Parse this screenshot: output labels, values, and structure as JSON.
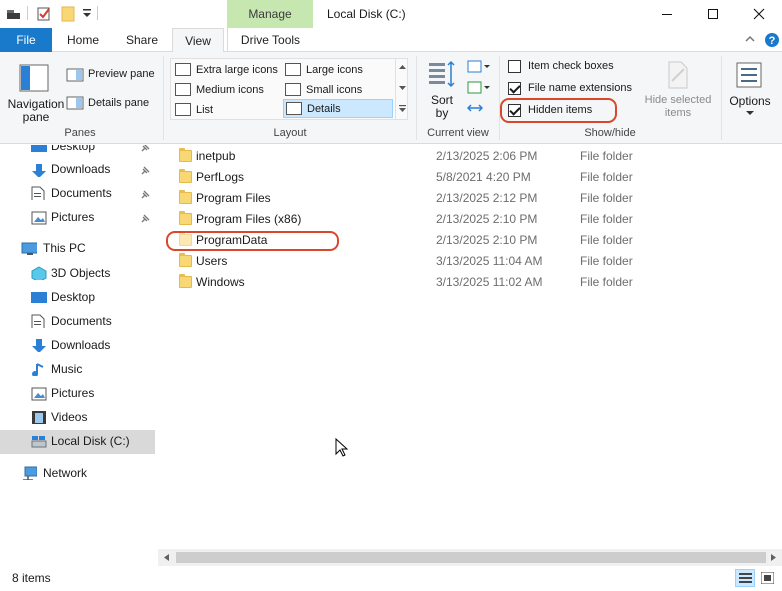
{
  "window": {
    "title": "Local Disk (C:)",
    "contextual_tab": "Manage",
    "controls": {
      "minimize": "—",
      "maximize": "☐",
      "close": "✕"
    }
  },
  "ribbon": {
    "tabs": [
      {
        "label": "File"
      },
      {
        "label": "Home"
      },
      {
        "label": "Share"
      },
      {
        "label": "View"
      },
      {
        "label": "Drive Tools"
      }
    ],
    "active_tab": "View",
    "groups": {
      "panes": {
        "label": "Panes",
        "navigation_pane": "Navigation pane",
        "preview_pane": "Preview pane",
        "details_pane": "Details pane"
      },
      "layout": {
        "label": "Layout",
        "items": [
          "Extra large icons",
          "Large icons",
          "Medium icons",
          "Small icons",
          "List",
          "Details"
        ],
        "selected": "Details"
      },
      "current_view": {
        "label": "Current view",
        "sort_by": "Sort by"
      },
      "show_hide": {
        "label": "Show/hide",
        "item_check_boxes": {
          "label": "Item check boxes",
          "checked": false
        },
        "file_name_extensions": {
          "label": "File name extensions",
          "checked": true
        },
        "hidden_items": {
          "label": "Hidden items",
          "checked": true
        },
        "hide_selected_items": "Hide selected items"
      },
      "options": {
        "label": "Options"
      }
    }
  },
  "sidebar": {
    "quick_access": [
      {
        "label": "Desktop",
        "icon": "desktop-icon",
        "pinned": true
      },
      {
        "label": "Downloads",
        "icon": "downloads-icon",
        "pinned": true
      },
      {
        "label": "Documents",
        "icon": "documents-icon",
        "pinned": true
      },
      {
        "label": "Pictures",
        "icon": "pictures-icon",
        "pinned": true
      }
    ],
    "this_pc": {
      "label": "This PC",
      "children": [
        {
          "label": "3D Objects",
          "icon": "3d-objects-icon"
        },
        {
          "label": "Desktop",
          "icon": "desktop-icon"
        },
        {
          "label": "Documents",
          "icon": "documents-icon"
        },
        {
          "label": "Downloads",
          "icon": "downloads-icon"
        },
        {
          "label": "Music",
          "icon": "music-icon"
        },
        {
          "label": "Pictures",
          "icon": "pictures-icon"
        },
        {
          "label": "Videos",
          "icon": "videos-icon"
        },
        {
          "label": "Local Disk (C:)",
          "icon": "drive-icon",
          "selected": true
        }
      ]
    },
    "network": {
      "label": "Network"
    }
  },
  "files": [
    {
      "name": "inetpub",
      "date": "2/13/2025 2:06 PM",
      "type": "File folder"
    },
    {
      "name": "PerfLogs",
      "date": "5/8/2021 4:20 PM",
      "type": "File folder"
    },
    {
      "name": "Program Files",
      "date": "2/13/2025 2:12 PM",
      "type": "File folder"
    },
    {
      "name": "Program Files (x86)",
      "date": "2/13/2025 2:10 PM",
      "type": "File folder"
    },
    {
      "name": "ProgramData",
      "date": "2/13/2025 2:10 PM",
      "type": "File folder",
      "hidden": true
    },
    {
      "name": "Users",
      "date": "3/13/2025 11:04 AM",
      "type": "File folder"
    },
    {
      "name": "Windows",
      "date": "3/13/2025 11:02 AM",
      "type": "File folder"
    }
  ],
  "status": {
    "item_count": "8 items"
  },
  "colors": {
    "file_tab": "#1979ca",
    "manage_tab": "#c7e7b0",
    "highlight_ring": "#d9482b",
    "selected_layout": "#cce8ff"
  }
}
